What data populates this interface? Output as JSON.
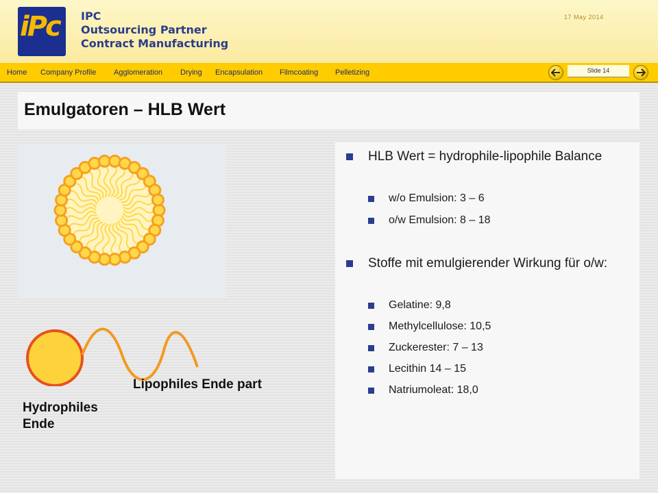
{
  "header": {
    "logo_text": "iPc",
    "company_lines": [
      "IPC",
      "Outsourcing Partner",
      "Contract Manufacturing"
    ],
    "date": "17 May 2014"
  },
  "nav": {
    "items": [
      "Home",
      "Company Profile",
      "Agglomeration",
      "Drying",
      "Encapsulation",
      "Filmcoating",
      "Pelletizing"
    ],
    "slide_label": "Slide 14"
  },
  "slide": {
    "title": "Emulgatoren – HLB Wert",
    "bullets": [
      {
        "text": "HLB Wert = hydrophile-lipophile Balance",
        "sub": [
          "w/o Emulsion: 3 – 6",
          "o/w Emulsion: 8 – 18"
        ]
      },
      {
        "text": "Stoffe mit emulgierender Wirkung für o/w:",
        "sub": [
          "Gelatine: 9,8",
          "Methylcellulose: 10,5",
          "Zuckerester: 7 – 13",
          "Lecithin 14 – 15",
          "Natriumoleat: 18,0"
        ]
      }
    ],
    "diagram": {
      "label_hydrophilic": "Hydrophiles Ende",
      "label_lipophilic": "Lipophiles Ende part"
    }
  },
  "colors": {
    "header_bg": "#fbeaa0",
    "nav_bg": "#ffcc00",
    "nav_text": "#1e2a66",
    "company_text": "#2a3c8c",
    "bullet": "#2b3d8f",
    "micelle_orange": "#f6a020",
    "micelle_yellow": "#ffd84a"
  }
}
